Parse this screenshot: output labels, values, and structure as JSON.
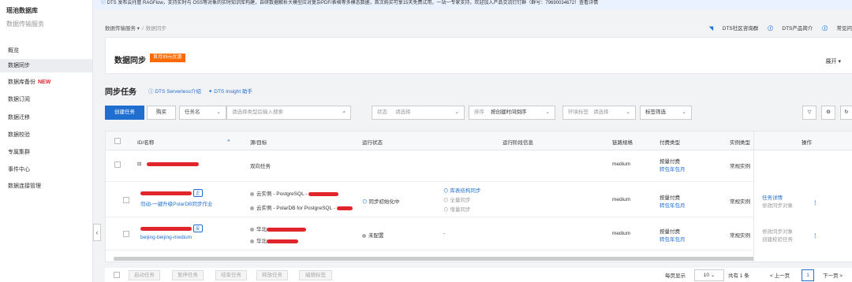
{
  "sidebar": {
    "title": "瑶池数据库",
    "subtitle": "数据传输服务",
    "items": [
      {
        "label": "概览"
      },
      {
        "label": "数据同步",
        "active": true
      },
      {
        "label": "数据库备份",
        "badge": "NEW"
      },
      {
        "label": "数据订阅"
      },
      {
        "label": "数据迁移"
      },
      {
        "label": "数据校验"
      },
      {
        "label": "专属集群"
      },
      {
        "label": "事件中心"
      },
      {
        "label": "数据连接管理"
      }
    ]
  },
  "banner": {
    "text": "DTS 发布云托管 RAGFlow，支持实时与 OSS等对象的实时知识库构建，自研数据解析大模型应对复杂PDF/表格等多模态数据，首次购买可享15天免费试用，一站一专家支持，欢迎加入产品交流钉钉群（群号：79690034672）查看详情"
  },
  "breadcrumb": {
    "parent": "数据传输服务",
    "sep": "/",
    "current": "数据同步"
  },
  "top_links": [
    "DTS社区咨询群",
    "DTS产品简介",
    "常见问"
  ],
  "card": {
    "title": "数据同步",
    "promo": "首月99元优惠",
    "expand": "展开 ▾"
  },
  "section": {
    "title": "同步任务",
    "links": [
      "DTS Serverless介绍",
      "DTS Insight 助手"
    ]
  },
  "toolbar": {
    "create": "创建任务",
    "purchase": "购买",
    "task_name": "任务名",
    "task_name_placeholder": "请选择类型后输入搜索",
    "status_label": "状态",
    "status_placeholder": "请选择",
    "sort_label": "排序",
    "sort_value": "按创建时间倒序",
    "env_label": "环境标签",
    "env_placeholder": "请选择",
    "tag_filter": "标签筛选"
  },
  "table": {
    "headers": [
      "ID/名称",
      "源/目标",
      "运行状态",
      "运行阶段信息",
      "链路规格",
      "付费类型",
      "实例类型",
      "操作"
    ],
    "group_row": {
      "name_masked": "dtsxxxxxx",
      "type": "双向任务",
      "spec": "medium",
      "pay": "按量付费",
      "pay_link": "转包年包月",
      "inst": "常规实例"
    },
    "rows": [
      {
        "id_masked": "dtsxxxxxx",
        "tag": "正",
        "desc": "勿动-一键升级PolarDB同步作业",
        "src": "云实例 - PostgreSQL - ",
        "dst": "云实例 - PolarDB for PostgreSQL - ",
        "status": "同步初始化中",
        "stages": [
          "库表结构同步",
          "全量同步",
          "增量同步"
        ],
        "spec": "medium",
        "pay": "按量付费",
        "pay_link": "转包年包月",
        "inst": "常规实例",
        "ops": [
          "任务详情",
          "修改同步对象"
        ]
      },
      {
        "id_masked": "dtsxxxxxx",
        "tag": "反",
        "desc": "beijing-beijing-medium",
        "src": "华北",
        "dst": "华北",
        "status": "未配置",
        "stages": [
          "-"
        ],
        "spec": "medium",
        "pay": "按量付费",
        "pay_link": "转包年包月",
        "inst": "常规实例",
        "ops": [
          "修改同步对象",
          "创建校验任务"
        ]
      }
    ]
  },
  "footer": {
    "buttons": [
      "启动任务",
      "暂停任务",
      "结束任务",
      "释放任务",
      "编辑标签"
    ],
    "per_page_label": "每页显示",
    "per_page": "10",
    "total": "共有 1 条",
    "prev": "< 上一页",
    "page": "1",
    "next": "下一页 >"
  },
  "colors": {
    "primary": "#1f6fd1",
    "promo": "#ff6a00",
    "mask": "#e0262b"
  }
}
